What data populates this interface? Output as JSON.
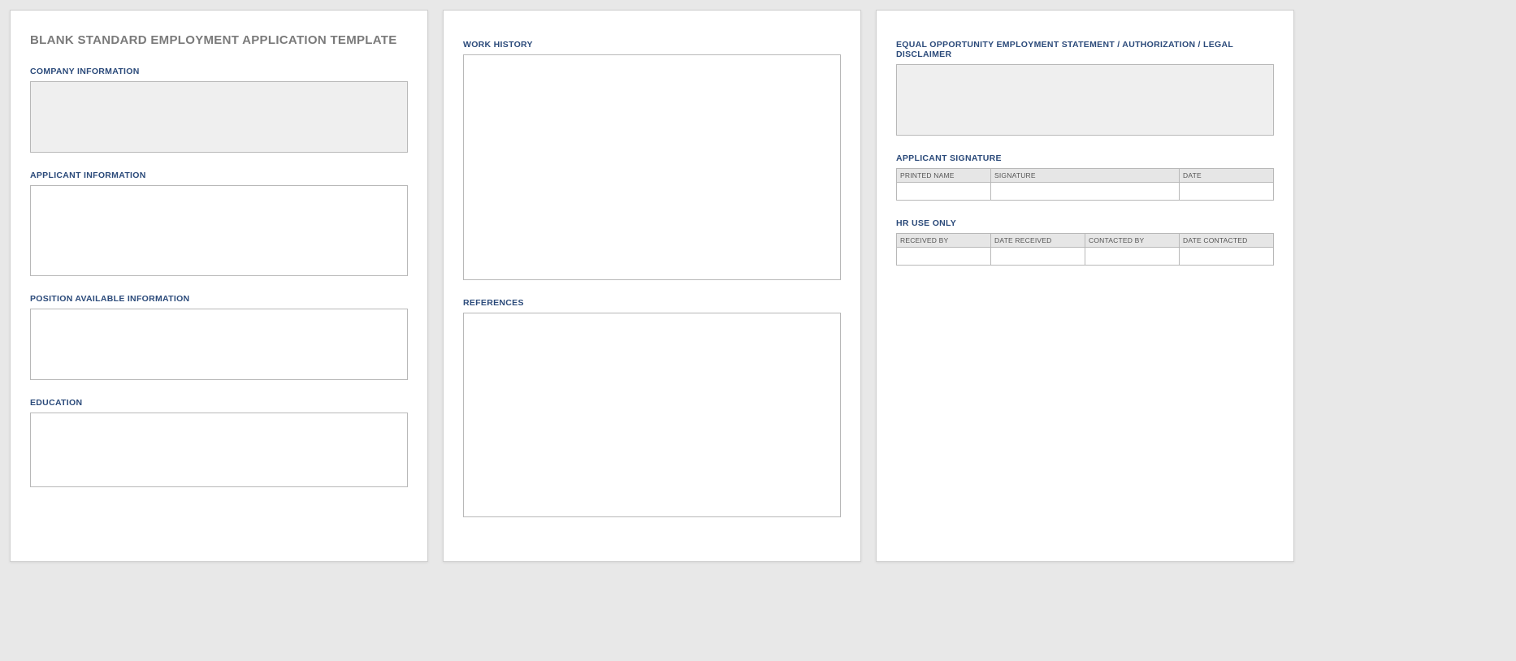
{
  "title": "BLANK STANDARD EMPLOYMENT APPLICATION TEMPLATE",
  "page1": {
    "company_info_label": "COMPANY INFORMATION",
    "applicant_info_label": "APPLICANT INFORMATION",
    "position_info_label": "POSITION AVAILABLE INFORMATION",
    "education_label": "EDUCATION"
  },
  "page2": {
    "work_history_label": "WORK HISTORY",
    "references_label": "REFERENCES"
  },
  "page3": {
    "eeo_label": "EQUAL OPPORTUNITY EMPLOYMENT STATEMENT / AUTHORIZATION / LEGAL DISCLAIMER",
    "signature_label": "APPLICANT SIGNATURE",
    "signature_cols": {
      "printed_name": "PRINTED NAME",
      "signature": "SIGNATURE",
      "date": "DATE"
    },
    "hr_label": "HR USE ONLY",
    "hr_cols": {
      "received_by": "RECEIVED BY",
      "date_received": "DATE RECEIVED",
      "contacted_by": "CONTACTED BY",
      "date_contacted": "DATE CONTACTED"
    }
  }
}
